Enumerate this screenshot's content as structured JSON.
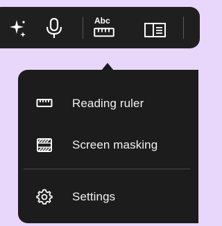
{
  "toolbar": {
    "icons": [
      "sparkle-icon",
      "microphone-icon",
      "abc-ruler-icon",
      "immersive-reader-icon"
    ],
    "ruler_icon_text": "Abc"
  },
  "menu": {
    "items": [
      {
        "label": "Reading ruler",
        "icon": "ruler-icon"
      },
      {
        "label": "Screen masking",
        "icon": "screen-mask-icon"
      },
      {
        "label": "Settings",
        "icon": "gear-icon"
      }
    ]
  },
  "colors": {
    "background": "#e8d7fb",
    "panel": "#1c1c1c",
    "text": "#f2f2f2",
    "divider": "#4a4a4a"
  }
}
